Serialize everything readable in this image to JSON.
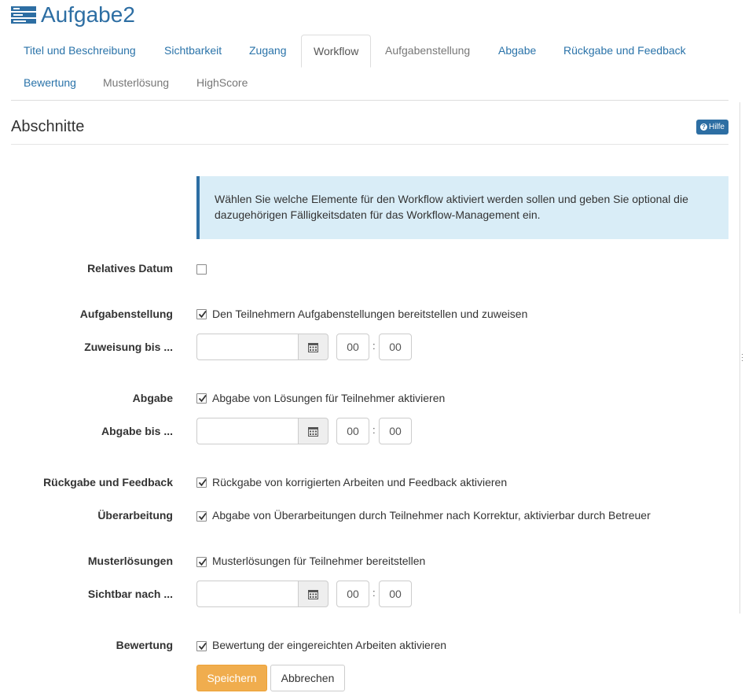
{
  "header": {
    "title": "Aufgabe2",
    "icon": "course-element-icon"
  },
  "tabs": [
    {
      "label": "Titel und Beschreibung"
    },
    {
      "label": "Sichtbarkeit"
    },
    {
      "label": "Zugang"
    },
    {
      "label": "Workflow"
    },
    {
      "label": "Aufgabenstellung"
    },
    {
      "label": "Abgabe"
    },
    {
      "label": "Rückgabe und Feedback"
    },
    {
      "label": "Bewertung"
    },
    {
      "label": "Musterlösung"
    },
    {
      "label": "HighScore"
    }
  ],
  "active_tab": "Workflow",
  "section": {
    "title": "Abschnitte",
    "help_label": "Hilfe"
  },
  "info": {
    "text": "Wählen Sie welche Elemente für den Workflow aktiviert werden sollen und geben Sie optional die dazugehörigen Fälligkeitsdaten für das Workflow-Management ein."
  },
  "form": {
    "relative_date": {
      "label": "Relatives Datum",
      "checked": false
    },
    "assignment": {
      "label": "Aufgabenstellung",
      "checkbox_text": "Den Teilnehmern Aufgabenstellungen bereitstellen und zuweisen",
      "checked": true
    },
    "assignment_until": {
      "label": "Zuweisung bis ...",
      "date": "",
      "hour": "00",
      "minute": "00"
    },
    "submission": {
      "label": "Abgabe",
      "checkbox_text": "Abgabe von Lösungen für Teilnehmer aktivieren",
      "checked": true
    },
    "submission_until": {
      "label": "Abgabe bis ...",
      "date": "",
      "hour": "00",
      "minute": "00"
    },
    "feedback": {
      "label": "Rückgabe und Feedback",
      "checkbox_text": "Rückgabe von korrigierten Arbeiten und Feedback aktivieren",
      "checked": true
    },
    "revision": {
      "label": "Überarbeitung",
      "checkbox_text": "Abgabe von Überarbeitungen durch Teilnehmer nach Korrektur, aktivierbar durch Betreuer",
      "checked": true
    },
    "solutions": {
      "label": "Musterlösungen",
      "checkbox_text": "Musterlösungen für Teilnehmer bereitstellen",
      "checked": true
    },
    "visible_after": {
      "label": "Sichtbar nach ...",
      "date": "",
      "hour": "00",
      "minute": "00"
    },
    "grading": {
      "label": "Bewertung",
      "checkbox_text": "Bewertung der eingereichten Arbeiten aktivieren",
      "checked": true
    },
    "time_separator": ":"
  },
  "actions": {
    "save_label": "Speichern",
    "cancel_label": "Abbrechen"
  },
  "colors": {
    "link": "#2a73a9",
    "primary": "#f0ad4e",
    "info_bg": "#d9edf7",
    "info_border": "#2d6ea3"
  }
}
